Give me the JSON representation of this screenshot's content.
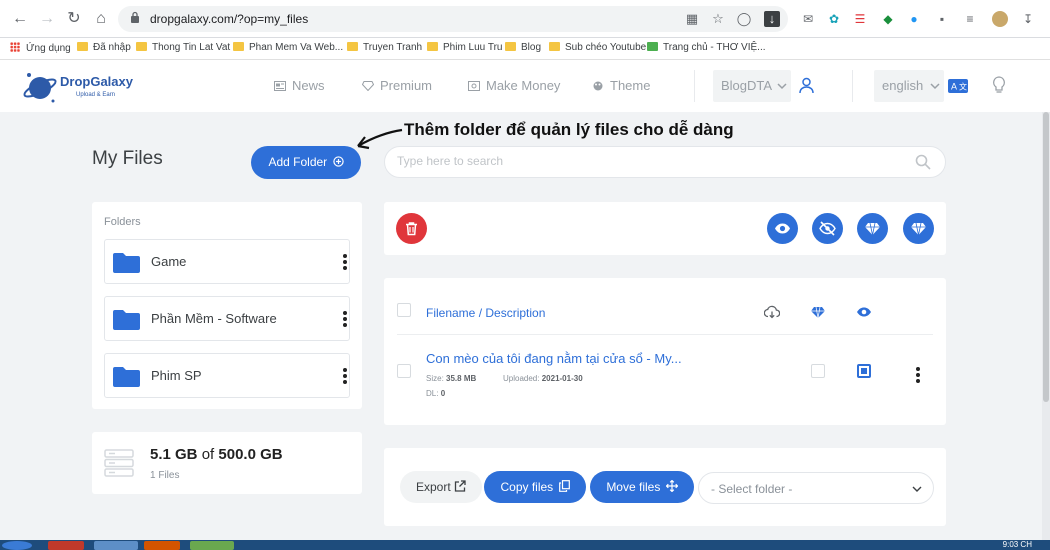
{
  "browser": {
    "url": "dropgalaxy.com/?op=my_files",
    "bookmarks": [
      "Ứng dụng",
      "Đã nhập",
      "Thong Tin Lat Vat",
      "Phan Mem Va Web...",
      "Truyen Tranh",
      "Phim Luu Tru",
      "Blog",
      "Sub chéo Youtube",
      "Trang chủ - THƠ VIỆ..."
    ]
  },
  "header": {
    "logo_name": "DropGalaxy",
    "logo_tagline": "Upload & Earn",
    "menu": [
      "News",
      "Premium",
      "Make Money",
      "Theme"
    ],
    "user": "BlogDTA",
    "language": "english"
  },
  "page": {
    "title": "My Files",
    "add_folder_label": "Add Folder",
    "annotation": "Thêm folder để quản lý files cho dễ dàng",
    "search_placeholder": "Type here to search"
  },
  "folders": {
    "label": "Folders",
    "items": [
      "Game",
      "Phần Mềm - Software",
      "Phim SP"
    ]
  },
  "storage": {
    "used": "5.1 GB",
    "of": "of",
    "total": "500.0 GB",
    "files": "1 Files"
  },
  "files": {
    "header_label": "Filename / Description",
    "rows": [
      {
        "name": "Con mèo của tôi đang nằm tại cửa sổ - My...",
        "size_label": "Size:",
        "size": "35.8 MB",
        "uploaded_label": "Uploaded:",
        "uploaded": "2021-01-30",
        "dl_label": "DL:",
        "dl": "0"
      }
    ]
  },
  "actions": {
    "export": "Export",
    "copy": "Copy files",
    "move": "Move files",
    "select_folder": "- Select folder -"
  },
  "taskbar": {
    "clock": "9:03 CH"
  },
  "colors": {
    "primary": "#2e6fd8",
    "delete": "#e0363b",
    "page_bg": "#f1f3f5"
  }
}
